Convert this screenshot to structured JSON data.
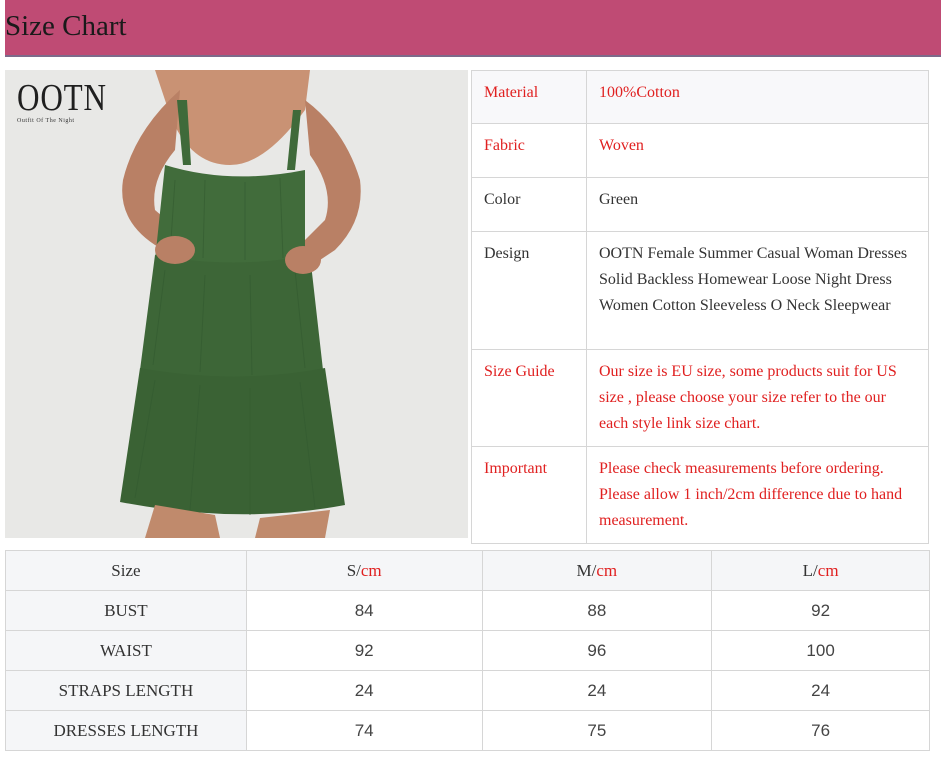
{
  "header": {
    "title": "Size Chart"
  },
  "logo": {
    "brand": "OOTN",
    "tagline": "Outfit Of The Night"
  },
  "details": [
    {
      "key": "Material",
      "value": "100%Cotton",
      "red": true
    },
    {
      "key": "Fabric",
      "value": "Woven",
      "red": true
    },
    {
      "key": "Color",
      "value": "Green",
      "red": false
    },
    {
      "key": "Design",
      "value": "OOTN Female Summer Casual Woman Dresses Solid Backless Homewear Loose Night Dress Women Cotton Sleeveless O Neck Sleepwear",
      "red": false
    },
    {
      "key": "Size Guide",
      "value": "Our size is EU size, some products suit for US size , please choose your size refer to the our each style link size chart.",
      "red": true
    },
    {
      "key": "Important",
      "value": "Please check measurements before ordering. Please allow 1 inch/2cm difference due to hand measurement.",
      "red": true
    }
  ],
  "size_table": {
    "header": "Size",
    "unit": "cm",
    "columns": [
      {
        "size": "S",
        "sep": "/"
      },
      {
        "size": "M",
        "sep": "/"
      },
      {
        "size": "L",
        "sep": "/"
      }
    ],
    "rows": [
      {
        "label": "BUST",
        "values": [
          "84",
          "88",
          "92"
        ]
      },
      {
        "label": "WAIST",
        "values": [
          "92",
          "96",
          "100"
        ]
      },
      {
        "label": "STRAPS LENGTH",
        "values": [
          "24",
          "24",
          "24"
        ]
      },
      {
        "label": "DRESSES LENGTH",
        "values": [
          "74",
          "75",
          "76"
        ]
      }
    ]
  },
  "colors": {
    "header_bg": "#bf4b74",
    "accent_red": "#e02020",
    "dress_green": "#3f6a3a"
  }
}
